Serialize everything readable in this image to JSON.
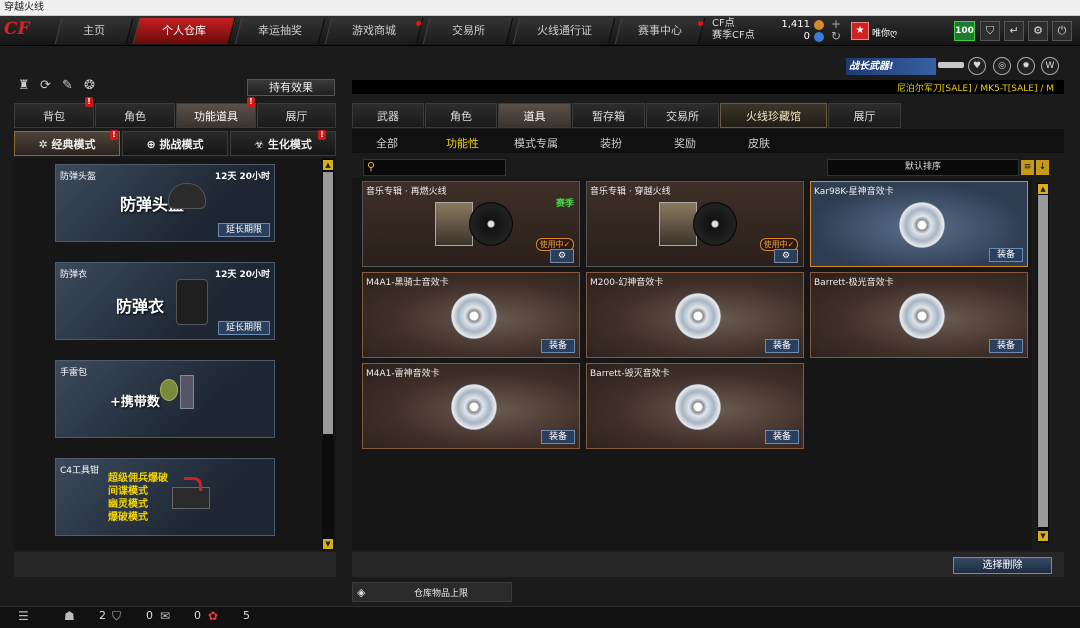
{
  "window": {
    "title": "穿越火线"
  },
  "top_nav": {
    "tabs": [
      {
        "label": "主页",
        "active": false
      },
      {
        "label": "个人仓库",
        "active": true
      },
      {
        "label": "幸运抽奖",
        "active": false
      },
      {
        "label": "游戏商城",
        "active": false
      },
      {
        "label": "交易所",
        "active": false
      },
      {
        "label": "火线通行证",
        "active": false
      },
      {
        "label": "赛事中心",
        "active": false
      }
    ],
    "cf_points_label": "CF点",
    "cf_points_value": "1,411",
    "season_cf_label": "赛季CF点",
    "season_cf_value": "0",
    "user_name": "唯你ღ",
    "level": "100"
  },
  "left_panel": {
    "effects_button": "持有效果",
    "category_tabs": [
      {
        "label": "背包",
        "active": false
      },
      {
        "label": "角色",
        "active": false
      },
      {
        "label": "功能道具",
        "active": true
      },
      {
        "label": "展厅",
        "active": false
      }
    ],
    "mode_tabs": [
      {
        "label": "经典模式",
        "active": true
      },
      {
        "label": "挑战模式",
        "active": false
      },
      {
        "label": "生化模式",
        "active": false
      }
    ],
    "items": [
      {
        "name": "防弹头盔",
        "time": "12天 20小时",
        "big_text": "防弹头盔",
        "action": "延长期限"
      },
      {
        "name": "防弹衣",
        "time": "12天 20小时",
        "big_text": "防弹衣",
        "action": "延长期限"
      },
      {
        "name": "手雷包",
        "big_text": "+携带数"
      },
      {
        "name": "C4工具钳",
        "lines": [
          "超级佣兵爆破",
          "间谍模式",
          "幽灵模式",
          "爆破模式"
        ]
      }
    ]
  },
  "right_panel": {
    "banner_text": "战长武器!",
    "sale_text": "尼泊尔军刀[SALE] / MK5-T[SALE] / M",
    "tabs": [
      {
        "label": "武器",
        "active": false
      },
      {
        "label": "角色",
        "active": false
      },
      {
        "label": "道具",
        "active": true
      },
      {
        "label": "暂存箱",
        "active": false
      },
      {
        "label": "交易所",
        "active": false
      },
      {
        "label": "火线珍藏馆",
        "active": false
      },
      {
        "label": "展厅",
        "active": false
      }
    ],
    "sub_tabs": [
      {
        "label": "全部",
        "active": false
      },
      {
        "label": "功能性",
        "active": true
      },
      {
        "label": "模式专属",
        "active": false
      },
      {
        "label": "装扮",
        "active": false
      },
      {
        "label": "奖励",
        "active": false
      },
      {
        "label": "皮肤",
        "active": false
      }
    ],
    "sort_label": "默认排序",
    "cards": [
      {
        "title": "音乐专辑 · 再燃火线",
        "season": "赛季",
        "in_use": "使用中✓"
      },
      {
        "title": "音乐专辑 · 穿越火线",
        "in_use": "使用中✓"
      },
      {
        "title": "Kar98K-星神音效卡",
        "action": "装备"
      },
      {
        "title": "M4A1-黑骑士音效卡",
        "action": "装备"
      },
      {
        "title": "M200-幻神音效卡",
        "action": "装备"
      },
      {
        "title": "Barrett-极光音效卡",
        "action": "装备"
      },
      {
        "title": "M4A1-雷神音效卡",
        "action": "装备"
      },
      {
        "title": "Barrett-毁灭音效卡",
        "action": "装备"
      }
    ],
    "delete_button": "选择删除",
    "storage_limit_label": "仓库物品上限"
  },
  "status_bar": {
    "counts": [
      "2",
      "0",
      "0",
      "5"
    ]
  }
}
